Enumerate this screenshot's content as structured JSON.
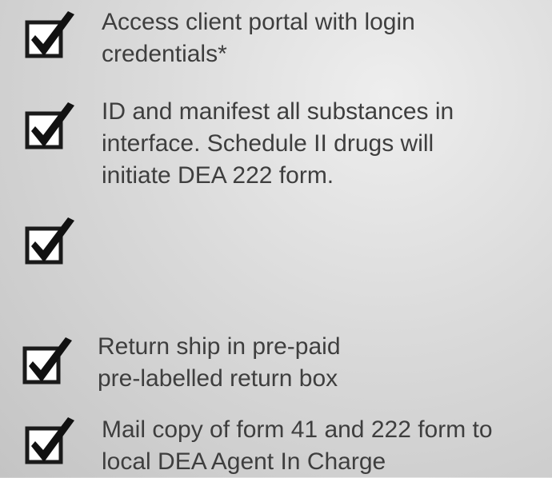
{
  "checklist": {
    "items": [
      {
        "icon": "checked-checkbox-icon",
        "checked": true,
        "lines": [
          "Access client portal with login",
          "credentials*"
        ]
      },
      {
        "icon": "checked-checkbox-icon",
        "checked": true,
        "lines": [
          "ID and manifest all substances in",
          "interface. Schedule II drugs will",
          "initiate DEA 222 form."
        ]
      },
      {
        "icon": "checked-checkbox-icon",
        "checked": true,
        "lines": []
      },
      {
        "icon": "checked-checkbox-icon",
        "checked": true,
        "lines": [
          "Return ship in pre-paid",
          "pre-labelled return box"
        ]
      },
      {
        "icon": "checked-checkbox-icon",
        "checked": true,
        "lines": [
          "Mail copy of form 41 and 222 form to",
          "local DEA Agent In Charge"
        ]
      }
    ]
  },
  "colors": {
    "text": "#3e3e3e",
    "check": "#111111",
    "box_border": "#1a1a1a",
    "box_fill": "#ffffff"
  }
}
